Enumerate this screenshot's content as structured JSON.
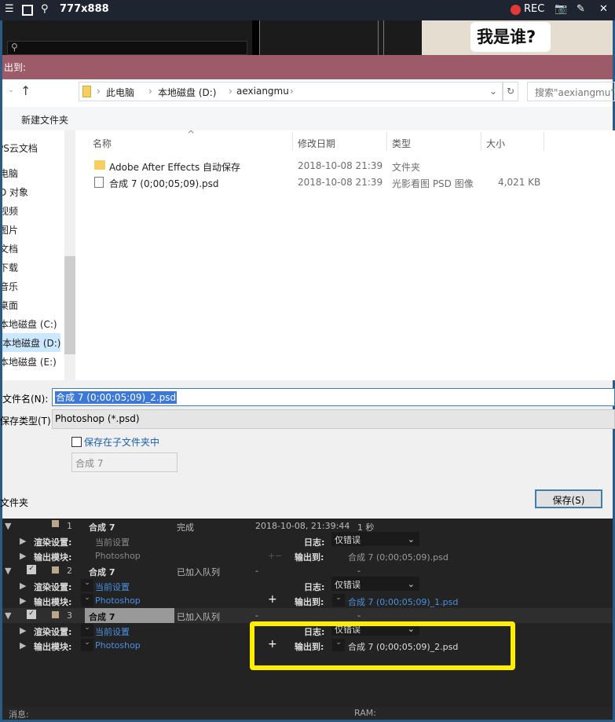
{
  "recorder": {
    "size_label": "777x888",
    "rec_label": "REC",
    "rec_color": "#e53935"
  },
  "preview": {
    "bubble_text": "我是谁?"
  },
  "dialog": {
    "title": "出到:",
    "breadcrumb": [
      "此电脑",
      "本地磁盘 (D:)",
      "aexiangmu"
    ],
    "search_placeholder": "搜索\"aexiangmu\"",
    "new_folder": "新建文件夹",
    "nav_items": [
      "PS云文档",
      "电脑",
      "D 对象",
      "视频",
      "图片",
      "文档",
      "下载",
      "音乐",
      "桌面",
      "本地磁盘 (C:)",
      "本地磁盘 (D:)",
      "本地磁盘 (E:)"
    ],
    "columns": {
      "name": "名称",
      "date": "修改日期",
      "type": "类型",
      "size": "大小"
    },
    "files": [
      {
        "name": "Adobe After Effects 自动保存",
        "date": "2018-10-08 21:39",
        "type": "文件夹",
        "size": ""
      },
      {
        "name": "合成 7 (0;00;05;09).psd",
        "date": "2018-10-08 21:39",
        "type": "光影看图 PSD 图像",
        "size": "4,021 KB"
      }
    ],
    "filename_label": "文件名(N):",
    "filename_value": "合成 7 (0;00;05;09)_2.psd",
    "filetype_label": "保存类型(T):",
    "filetype_value": "Photoshop (*.psd)",
    "subfolder_label": "保存在子文件夹中",
    "subfolder_value": "合成 7",
    "hide_folders": "文件夹",
    "save_button": "保存(S)"
  },
  "render_queue": {
    "items": [
      {
        "num": "1",
        "name": "合成 7",
        "status": "完成",
        "started": "2018-10-08, 21:39:44",
        "time": "1 秒",
        "render_label": "渲染设置:",
        "render_value": "当前设置",
        "output_label": "输出模块:",
        "output_value": "Photoshop",
        "log_label": "日志:",
        "log_value": "仅错误",
        "outto_label": "输出到:",
        "outto_value": "合成 7 (0;00;05;09).psd"
      },
      {
        "num": "2",
        "name": "合成 7",
        "status": "已加入队列",
        "started": "-",
        "time": "-",
        "render_label": "渲染设置:",
        "render_value": "当前设置",
        "output_label": "输出模块:",
        "output_value": "Photoshop",
        "log_label": "日志:",
        "log_value": "仅错误",
        "outto_label": "输出到:",
        "outto_value": "合成 7 (0;00;05;09)_1.psd"
      },
      {
        "num": "3",
        "name": "合成 7",
        "status": "已加入队列",
        "started": "-",
        "time": "-",
        "render_label": "渲染设置:",
        "render_value": "当前设置",
        "output_label": "输出模块:",
        "output_value": "Photoshop",
        "log_label": "日志:",
        "log_value": "仅错误",
        "outto_label": "输出到:",
        "outto_value": "合成 7 (0;00;05;09)_2.psd"
      }
    ],
    "messages_label": "消息:",
    "ram_label": "RAM:",
    "highlight_color": "#ffee00"
  }
}
